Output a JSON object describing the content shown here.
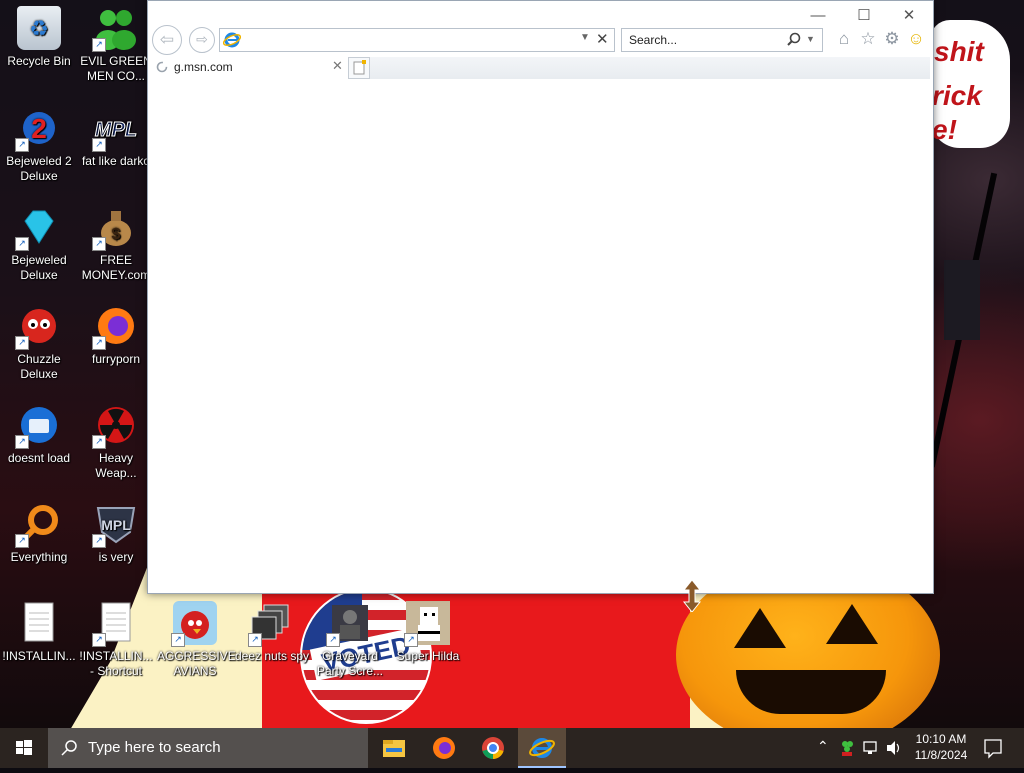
{
  "desktop": {
    "icons": [
      {
        "label": "Recycle Bin",
        "icon": "recycle-bin-icon"
      },
      {
        "label": "EVIL GREEN MEN CO...",
        "icon": "green-men-icon"
      },
      {
        "label": "Bejeweled 2 Deluxe",
        "icon": "bejeweled2-icon"
      },
      {
        "label": "fat like darko",
        "icon": "mpl-icon"
      },
      {
        "label": "Bejeweled Deluxe",
        "icon": "diamond-icon"
      },
      {
        "label": "FREE MONEY.com",
        "icon": "money-bag-icon"
      },
      {
        "label": "Chuzzle Deluxe",
        "icon": "chuzzle-icon"
      },
      {
        "label": "furryporn",
        "icon": "firefox-icon"
      },
      {
        "label": "doesnt load",
        "icon": "thunderbird-icon"
      },
      {
        "label": "Heavy Weap...",
        "icon": "radiation-icon"
      },
      {
        "label": "Everything",
        "icon": "search-magnifier-icon"
      },
      {
        "label": "is very",
        "icon": "mpl-shield-icon"
      },
      {
        "label": "!INSTALLIN...",
        "icon": "text-file-icon"
      },
      {
        "label": "!INSTALLIN... - Shortcut",
        "icon": "text-file-icon"
      },
      {
        "label": "AGGRESSIVE AVIANS",
        "icon": "angry-bird-icon"
      },
      {
        "label": "deez nuts spy",
        "icon": "windows-stack-icon"
      },
      {
        "label": "Graveyard Party Scre...",
        "icon": "graveyard-icon"
      },
      {
        "label": "Super Hilda",
        "icon": "pixel-hilda-icon"
      }
    ],
    "wallpaper_text": [
      "shit",
      "rick",
      "e!"
    ],
    "voted_text": "VOTED"
  },
  "browser": {
    "window_controls": {
      "minimize": "—",
      "maximize": "☐",
      "close": "✕"
    },
    "address_value": "",
    "search_placeholder": "Search...",
    "tab_title": "g.msn.com",
    "accent_color": "#1e88e5"
  },
  "taskbar": {
    "search_placeholder": "Type here to search",
    "apps": [
      "file-explorer-icon",
      "firefox-icon",
      "chrome-icon",
      "internet-explorer-icon"
    ],
    "clock_time": "10:10 AM",
    "clock_date": "11/8/2024"
  }
}
